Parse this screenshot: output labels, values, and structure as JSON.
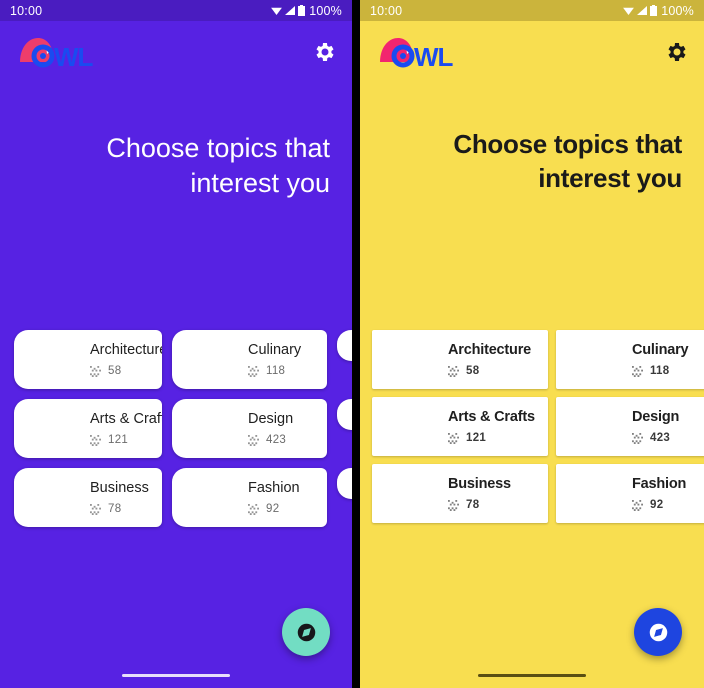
{
  "panels": [
    {
      "theme": "purple",
      "status": {
        "clock": "10:00",
        "battery": "100%"
      },
      "appbar": {
        "logo_text": "OWL",
        "settings_label": "Settings"
      },
      "headline": "Choose topics that interest you",
      "fab": {
        "icon": "explore-icon",
        "label": "Explore"
      },
      "colors": {
        "background": "#5722E3",
        "statusbar": "#4A1CC0",
        "selected": "#E8257E",
        "fab": "#72DDC3",
        "headline_text": "#FFFFFF"
      }
    },
    {
      "theme": "yellow",
      "status": {
        "clock": "10:00",
        "battery": "100%"
      },
      "appbar": {
        "logo_text": "OWL",
        "settings_label": "Settings"
      },
      "headline": "Choose topics that interest you",
      "fab": {
        "icon": "explore-icon",
        "label": "Explore"
      },
      "colors": {
        "background": "#F8DE50",
        "statusbar": "#CBB43C",
        "selected": "#EE2E7F",
        "fab": "#1E45E0",
        "headline_text": "#1A1A1A"
      }
    }
  ],
  "topics": [
    {
      "name": "Architecture",
      "count": "58",
      "selected": true,
      "image": "architecture-building-photo"
    },
    {
      "name": "Culinary",
      "count": "118",
      "selected": false,
      "image": "culinary-chopping-photo"
    },
    {
      "name": "Arts & Crafts",
      "count": "121",
      "selected": false,
      "image": "pottery-hands-photo"
    },
    {
      "name": "Design",
      "count": "423",
      "selected": true,
      "image": "design-desk-photo"
    },
    {
      "name": "Business",
      "count": "78",
      "selected": true,
      "image": "business-suit-photo"
    },
    {
      "name": "Fashion",
      "count": "92",
      "selected": false,
      "image": "fashion-fabric-photo"
    }
  ],
  "partial_topics": [
    {
      "name": "",
      "count": "",
      "selected": false,
      "image": "partial-card-grey-photo"
    },
    {
      "name": "",
      "count": "",
      "selected": false,
      "image": "partial-card-dark-photo"
    },
    {
      "name": "",
      "count": "",
      "selected": false,
      "image": "partial-card-chalkboard-photo"
    }
  ],
  "icons": {
    "grain": "grain-icon",
    "check": "check-icon",
    "gear": "gear-icon",
    "wifi": "wifi-icon",
    "cell": "cell-signal-icon",
    "battery": "battery-icon",
    "explore": "explore-compass-icon"
  }
}
